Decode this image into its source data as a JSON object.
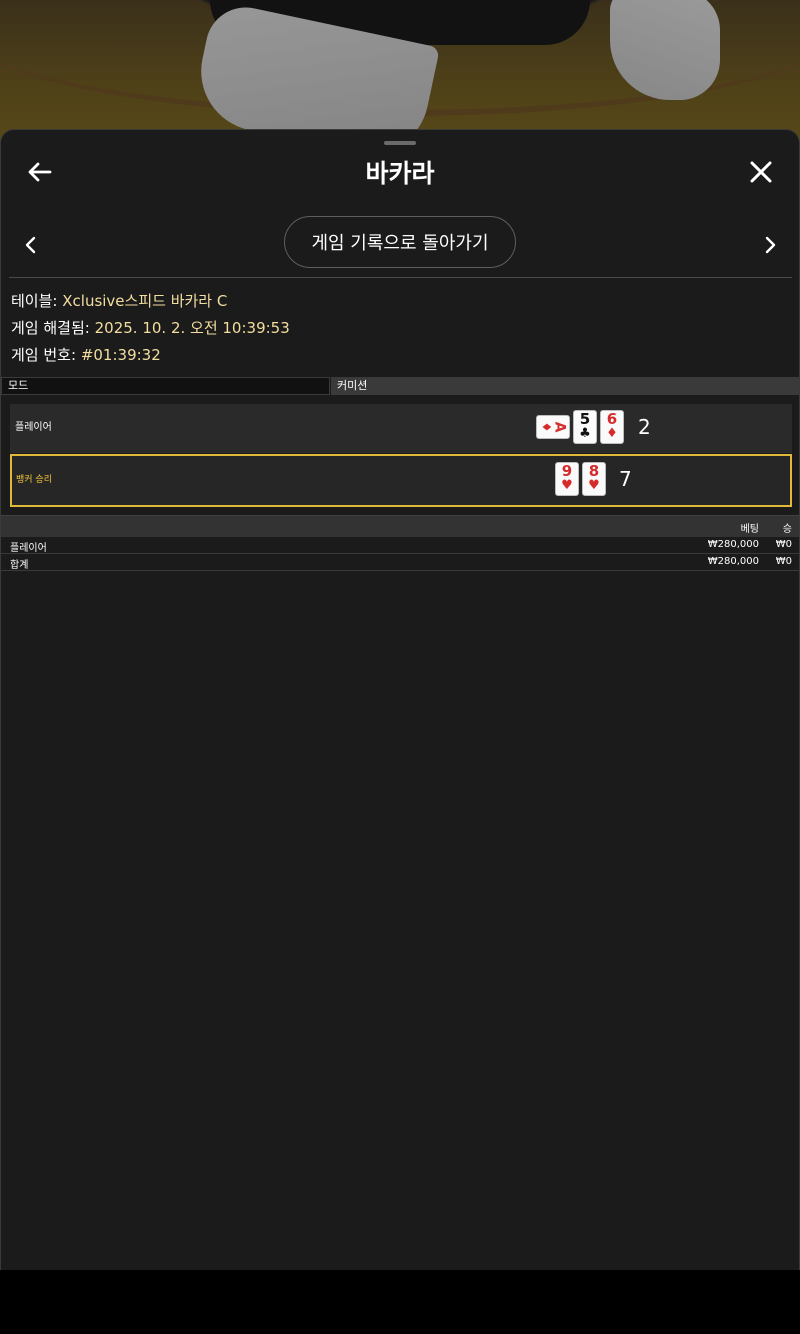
{
  "header": {
    "title": "바카라"
  },
  "nav": {
    "history_button": "게임 기록으로 돌아가기"
  },
  "info": {
    "table_label": "테이블:",
    "table_value": "Xclusive스피드 바카라 C",
    "resolved_label": "게임 해결됨:",
    "resolved_value": "2025. 10. 2. 오전 10:39:53",
    "game_no_label": "게임 번호:",
    "game_no_value": "#01:39:32"
  },
  "mode_bar": {
    "mode_label": "모드",
    "commission_label": "커미션"
  },
  "hands": {
    "player": {
      "label": "플레이어",
      "score": "2",
      "cards": [
        {
          "rank": "A",
          "suit": "♦",
          "color": "red",
          "sideways": true
        },
        {
          "rank": "5",
          "suit": "♣",
          "color": "black",
          "sideways": false
        },
        {
          "rank": "6",
          "suit": "♦",
          "color": "red",
          "sideways": false
        }
      ]
    },
    "banker": {
      "label": "뱅커 승리",
      "score": "7",
      "cards": [
        {
          "rank": "9",
          "suit": "♥",
          "color": "red",
          "sideways": false
        },
        {
          "rank": "8",
          "suit": "♥",
          "color": "red",
          "sideways": false
        }
      ]
    }
  },
  "bets": {
    "col_bet": "베팅",
    "col_win": "승",
    "rows": [
      {
        "name": "플레이어",
        "bet": "₩280,000",
        "win": "₩0"
      },
      {
        "name": "합계",
        "bet": "₩280,000",
        "win": "₩0"
      }
    ]
  },
  "colors": {
    "accent_gold": "#e0b93a",
    "info_value": "#f3dea0",
    "sheet_bg": "#1b1b1b"
  },
  "icons": {
    "back": "arrow-left-icon",
    "close": "close-icon",
    "prev": "chevron-left-icon",
    "next": "chevron-right-icon"
  }
}
